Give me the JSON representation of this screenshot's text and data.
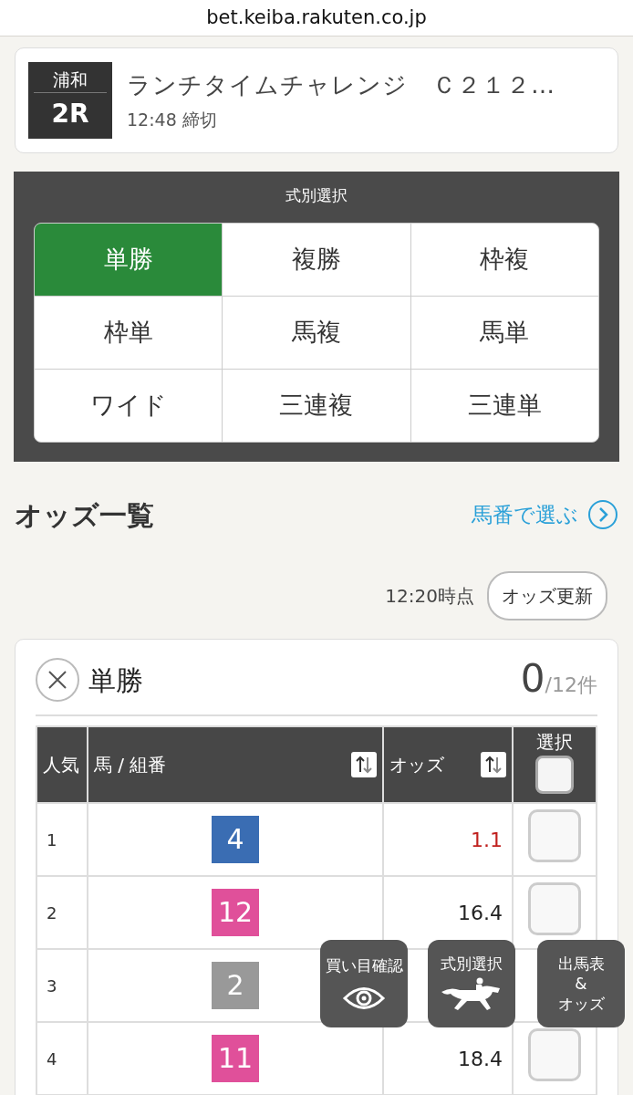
{
  "address_bar": {
    "url": "bet.keiba.rakuten.co.jp"
  },
  "race": {
    "venue": "浦和",
    "number": "2R",
    "name": "ランチタイムチャレンジ　Ｃ２１２…",
    "deadline": "12:48 締切"
  },
  "bet_types": {
    "title": "式別選択",
    "items": [
      {
        "label": "単勝",
        "selected": true
      },
      {
        "label": "複勝",
        "selected": false
      },
      {
        "label": "枠複",
        "selected": false
      },
      {
        "label": "枠単",
        "selected": false
      },
      {
        "label": "馬複",
        "selected": false
      },
      {
        "label": "馬単",
        "selected": false
      },
      {
        "label": "ワイド",
        "selected": false
      },
      {
        "label": "三連複",
        "selected": false
      },
      {
        "label": "三連単",
        "selected": false
      }
    ]
  },
  "odds": {
    "heading": "オッズ一覧",
    "link": "馬番で選ぶ",
    "timestamp": "12:20時点",
    "refresh_button": "オッズ更新"
  },
  "selection": {
    "bet_type": "単勝",
    "count": "0",
    "total": "/12件",
    "columns": [
      "人気",
      "馬 / 組番",
      "オッズ",
      "選択"
    ],
    "select_all_checked": false,
    "rows": [
      {
        "rank": "1",
        "horse": "4",
        "color": "#3a6db3",
        "odds": "1.1",
        "favorite": true,
        "checked": false
      },
      {
        "rank": "2",
        "horse": "12",
        "color": "#e0509a",
        "odds": "16.4",
        "favorite": false,
        "checked": false
      },
      {
        "rank": "3",
        "horse": "2",
        "color": "#999999"
      },
      {
        "rank": "4",
        "horse": "11",
        "color": "#e0509a",
        "odds": "18.4",
        "favorite": false,
        "checked": false
      }
    ]
  },
  "floating_buttons": [
    {
      "label": "買い目確認",
      "kind": "eye"
    },
    {
      "label": "式別選択",
      "kind": "horse"
    },
    {
      "label": "出馬表\n&\nオッズ",
      "kind": "text"
    }
  ]
}
